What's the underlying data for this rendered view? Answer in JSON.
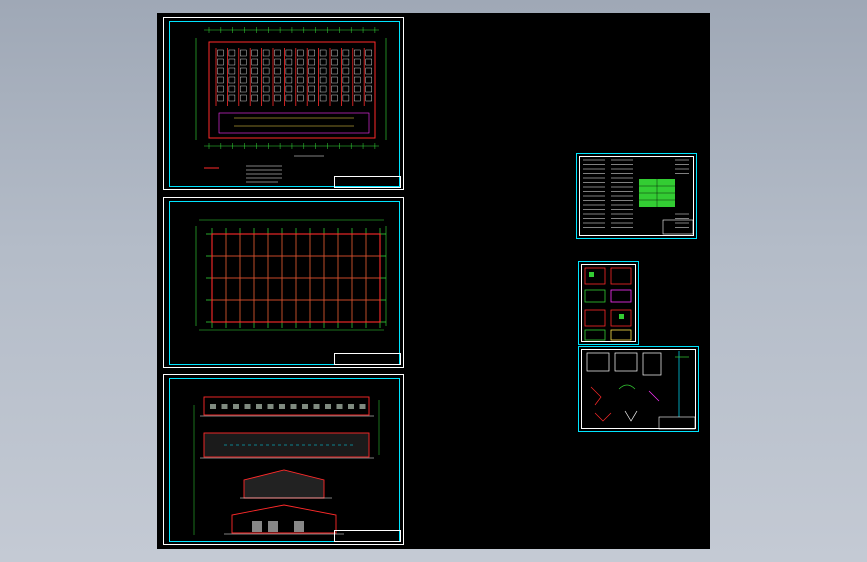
{
  "app": {
    "viewport_label": ""
  },
  "colors": {
    "canvas": "#000000",
    "border_outer": "#ffffff",
    "border_inner": "#00e5ff",
    "structure_red": "#ff2a2a",
    "grid_green": "#35e03a",
    "dim_yellow": "#ffe34d",
    "highlight_green": "#33cc33",
    "magenta": "#ff33ff"
  },
  "sheets": [
    {
      "id": "floor-plan",
      "description_icon": "floor-plan-drawing-icon"
    },
    {
      "id": "structural-grid",
      "description_icon": "structural-grid-drawing-icon"
    },
    {
      "id": "elevations-sections",
      "description_icon": "elevation-drawing-icon"
    },
    {
      "id": "notes-table",
      "description_icon": "notes-table-drawing-icon"
    },
    {
      "id": "details-small",
      "description_icon": "detail-drawing-icon"
    },
    {
      "id": "details-large",
      "description_icon": "detail-drawing-icon"
    }
  ]
}
